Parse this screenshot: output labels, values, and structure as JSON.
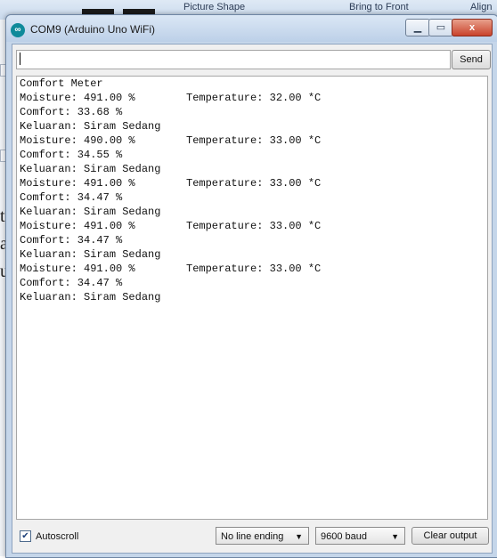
{
  "background": {
    "ribbon_items": [
      "Picture Shape",
      "Bring to Front",
      "Align"
    ],
    "letters": [
      "t",
      "a",
      "u"
    ]
  },
  "window": {
    "title": "COM9 (Arduino Uno WiFi)",
    "controls": {
      "minimize": "▁",
      "maximize": "▭",
      "close": "x"
    }
  },
  "input": {
    "value": "",
    "send_label": "Send"
  },
  "output": {
    "header": "Comfort Meter",
    "blocks": [
      {
        "moisture": "Moisture: 491.00 %",
        "temperature": "Temperature: 32.00 *C",
        "comfort": "Comfort: 33.68 %",
        "keluaran": "Keluaran: Siram Sedang"
      },
      {
        "moisture": "Moisture: 490.00 %",
        "temperature": "Temperature: 33.00 *C",
        "comfort": "Comfort: 34.55 %",
        "keluaran": "Keluaran: Siram Sedang"
      },
      {
        "moisture": "Moisture: 491.00 %",
        "temperature": "Temperature: 33.00 *C",
        "comfort": "Comfort: 34.47 %",
        "keluaran": "Keluaran: Siram Sedang"
      },
      {
        "moisture": "Moisture: 491.00 %",
        "temperature": "Temperature: 33.00 *C",
        "comfort": "Comfort: 34.47 %",
        "keluaran": "Keluaran: Siram Sedang"
      },
      {
        "moisture": "Moisture: 491.00 %",
        "temperature": "Temperature: 33.00 *C",
        "comfort": "Comfort: 34.47 %",
        "keluaran": "Keluaran: Siram Sedang"
      }
    ]
  },
  "bottom": {
    "autoscroll_label": "Autoscroll",
    "autoscroll_checked": true,
    "line_ending": "No line ending",
    "baud": "9600 baud",
    "clear_label": "Clear output"
  },
  "colors": {
    "title_bar": "#c9d9ec",
    "close_button": "#c9432c",
    "app_icon": "#0f8a9a"
  }
}
